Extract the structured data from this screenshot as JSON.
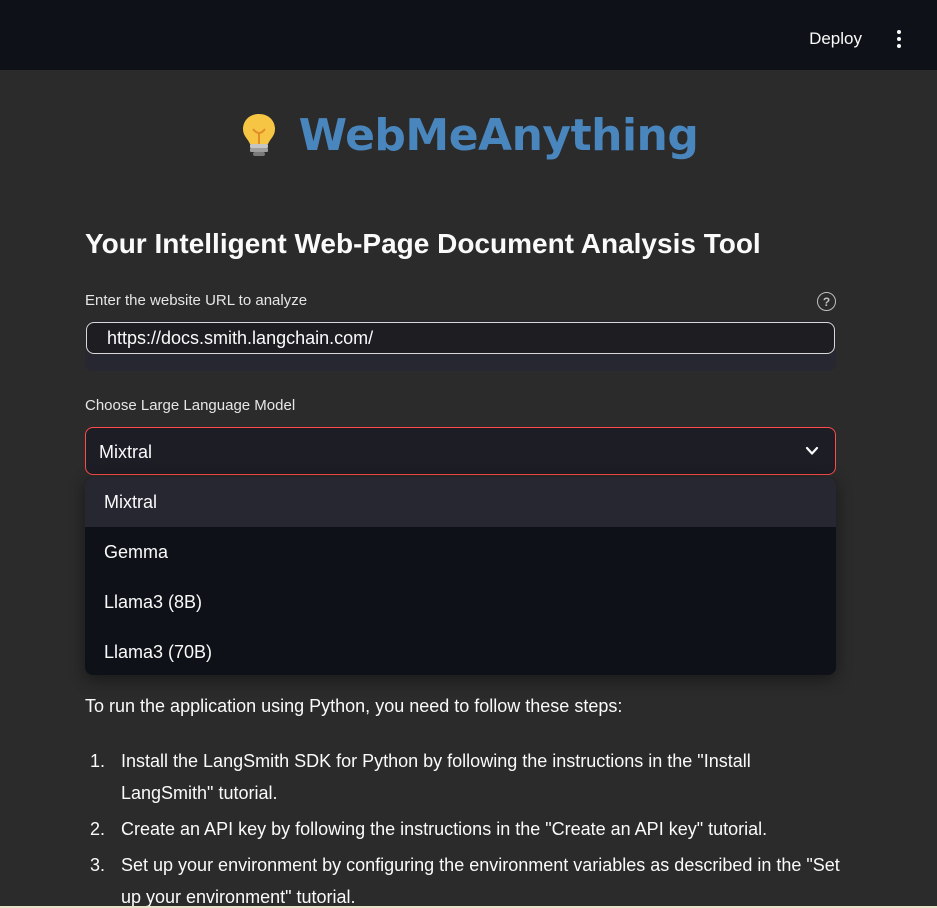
{
  "header": {
    "deploy_label": "Deploy",
    "menu_icon": "kebab-menu-icon"
  },
  "hero": {
    "icon": "lightbulb-icon",
    "title": "WebMeAnything",
    "title_color": "#4a86be"
  },
  "subtitle": "Your Intelligent Web-Page Document Analysis Tool",
  "url_field": {
    "label": "Enter the website URL to analyze",
    "help_icon": "question-circle-icon",
    "value": "https://docs.smith.langchain.com/"
  },
  "model_select": {
    "label": "Choose Large Language Model",
    "selected": "Mixtral",
    "options": [
      "Mixtral",
      "Gemma",
      "Llama3 (8B)",
      "Llama3 (70B)"
    ],
    "focus_color": "#ff4b4b"
  },
  "instructions": {
    "intro": "To run the application using Python, you need to follow these steps:",
    "steps": [
      {
        "num": "1.",
        "text": "Install the LangSmith SDK for Python by following the instructions in the \"Install LangSmith\" tutorial."
      },
      {
        "num": "2.",
        "text": "Create an API key by following the instructions in the \"Create an API key\" tutorial."
      },
      {
        "num": "3.",
        "text": "Set up your environment by configuring the environment variables as described in the \"Set up your environment\" tutorial."
      }
    ]
  }
}
